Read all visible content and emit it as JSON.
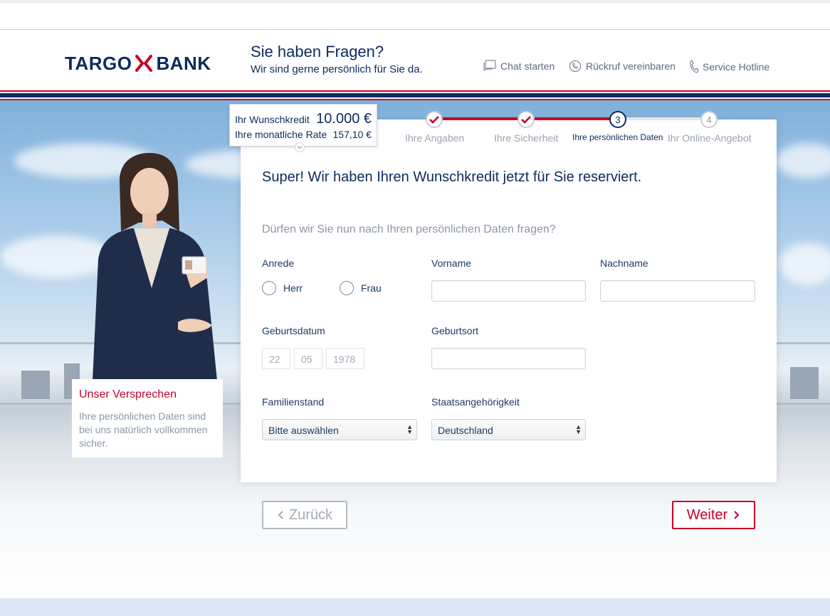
{
  "header": {
    "logo_left": "TARGO",
    "logo_right": "BANK",
    "title": "Sie haben Fragen?",
    "subtitle": "Wir sind gerne persönlich für Sie da.",
    "links": [
      {
        "label": "Chat starten",
        "icon": "chat-icon"
      },
      {
        "label": "Rückruf vereinbaren",
        "icon": "callback-icon"
      },
      {
        "label": "Service Hotline",
        "icon": "phone-icon"
      }
    ]
  },
  "summary": {
    "credit_label": "Ihr Wunschkredit",
    "credit_value": "10.000 €",
    "rate_label": "Ihre monatliche Rate",
    "rate_value": "157,10 €"
  },
  "stepper": {
    "steps": [
      {
        "label": "Ihre Angaben",
        "state": "done"
      },
      {
        "label": "Ihre Sicherheit",
        "state": "done"
      },
      {
        "number": "3",
        "label": "Ihre persönlichen Daten",
        "state": "current"
      },
      {
        "number": "4",
        "label": "Ihr Online-Angebot",
        "state": "todo"
      }
    ]
  },
  "form": {
    "headline": "Super! Wir haben Ihren Wunschkredit jetzt für Sie reserviert.",
    "question": "Dürfen wir Sie nun nach Ihren persönlichen Daten fragen?",
    "salutation_label": "Anrede",
    "salutation_options": [
      "Herr",
      "Frau"
    ],
    "firstname_label": "Vorname",
    "firstname_value": "",
    "lastname_label": "Nachname",
    "lastname_value": "",
    "birthdate_label": "Geburtsdatum",
    "birthdate_day_placeholder": "22",
    "birthdate_month_placeholder": "05",
    "birthdate_year_placeholder": "1978",
    "birthplace_label": "Geburtsort",
    "birthplace_value": "",
    "marital_label": "Familienstand",
    "marital_value": "Bitte auswählen",
    "nationality_label": "Staatsangehörigkeit",
    "nationality_value": "Deutschland"
  },
  "buttons": {
    "back": "Zurück",
    "next": "Weiter"
  },
  "promise": {
    "title": "Unser Versprechen",
    "text": "Ihre persönlichen Daten sind bei uns natürlich vollkommen sicher."
  },
  "colors": {
    "brand_blue": "#0b2b5e",
    "brand_red": "#c4002a"
  }
}
